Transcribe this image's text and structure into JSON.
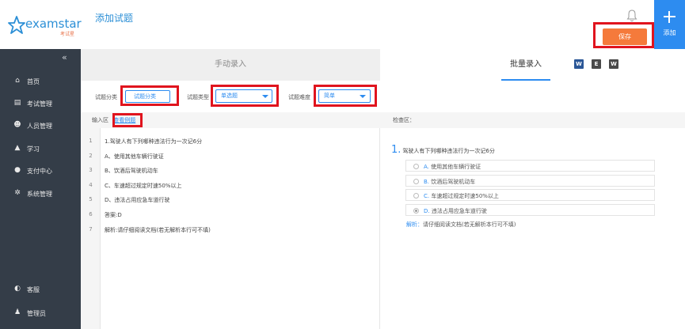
{
  "app": {
    "brand": "examstar",
    "brand_sub": "考试星",
    "page_title": "添加试题"
  },
  "header": {
    "save_label": "保存",
    "add_label": "添加"
  },
  "sidebar": {
    "collapse_glyph": "«",
    "items": [
      {
        "label": "首页",
        "icon": "home-icon",
        "glyph": "⌂"
      },
      {
        "label": "考试管理",
        "icon": "clipboard-icon",
        "glyph": "▤"
      },
      {
        "label": "人员管理",
        "icon": "users-icon",
        "glyph": "☻"
      },
      {
        "label": "学习",
        "icon": "graduation-cap-icon",
        "glyph": "▲"
      },
      {
        "label": "支付中心",
        "icon": "wallet-icon",
        "glyph": "●"
      },
      {
        "label": "系统管理",
        "icon": "gears-icon",
        "glyph": "✲"
      }
    ],
    "bottom_items": [
      {
        "label": "客服",
        "icon": "headset-icon",
        "glyph": "◐"
      },
      {
        "label": "管理员",
        "icon": "user-icon",
        "glyph": "♟"
      }
    ]
  },
  "tabs": {
    "manual": "手动录入",
    "batch": "批量录入",
    "file_icons": [
      {
        "name": "word-file-icon",
        "letter": "W",
        "color": "#2b5797"
      },
      {
        "name": "excel-file-icon",
        "letter": "E",
        "color": "#4a4a4a"
      },
      {
        "name": "doc-file-icon",
        "letter": "W",
        "color": "#4a4a4a"
      }
    ]
  },
  "filters": {
    "category_label": "试题分类",
    "category_value": "试题分类",
    "type_label": "试题类型",
    "type_value": "单选题",
    "difficulty_label": "试题难度",
    "difficulty_value": "简单"
  },
  "input_area": {
    "label": "输入区",
    "example_link": "查看例题",
    "lines": [
      {
        "n": "1",
        "text": "1.驾驶人有下列哪种违法行为一次记6分"
      },
      {
        "n": "2",
        "text": "A、使用其他车辆行驶证"
      },
      {
        "n": "3",
        "text": "B、饮酒后驾驶机动车"
      },
      {
        "n": "4",
        "text": "C、车速超过规定时速50%以上"
      },
      {
        "n": "5",
        "text": "D、违法占用应急车道行驶"
      },
      {
        "n": "6",
        "text": "答案:D"
      },
      {
        "n": "7",
        "text": "解析:请仔细阅读文档(若无解析本行可不填)"
      }
    ]
  },
  "check_area": {
    "label": "检查区：",
    "question_number": "1.",
    "question_text": "驾驶人有下列哪种违法行为一次记6分",
    "options": [
      {
        "letter": "A.",
        "text": "使用其他车辆行驶证",
        "selected": false
      },
      {
        "letter": "B.",
        "text": "饮酒后驾驶机动车",
        "selected": false
      },
      {
        "letter": "C.",
        "text": "车速超过规定时速50%以上",
        "selected": false
      },
      {
        "letter": "D.",
        "text": "违法占用应急车道行驶",
        "selected": true
      }
    ],
    "analysis_key": "解析：",
    "analysis_text": "请仔细阅读文档(若无解析本行可不填)"
  },
  "colors": {
    "accent": "#2d8cf0",
    "save": "#f57a3b",
    "sidebar_bg": "#343d48",
    "highlight": "#e0141e"
  }
}
